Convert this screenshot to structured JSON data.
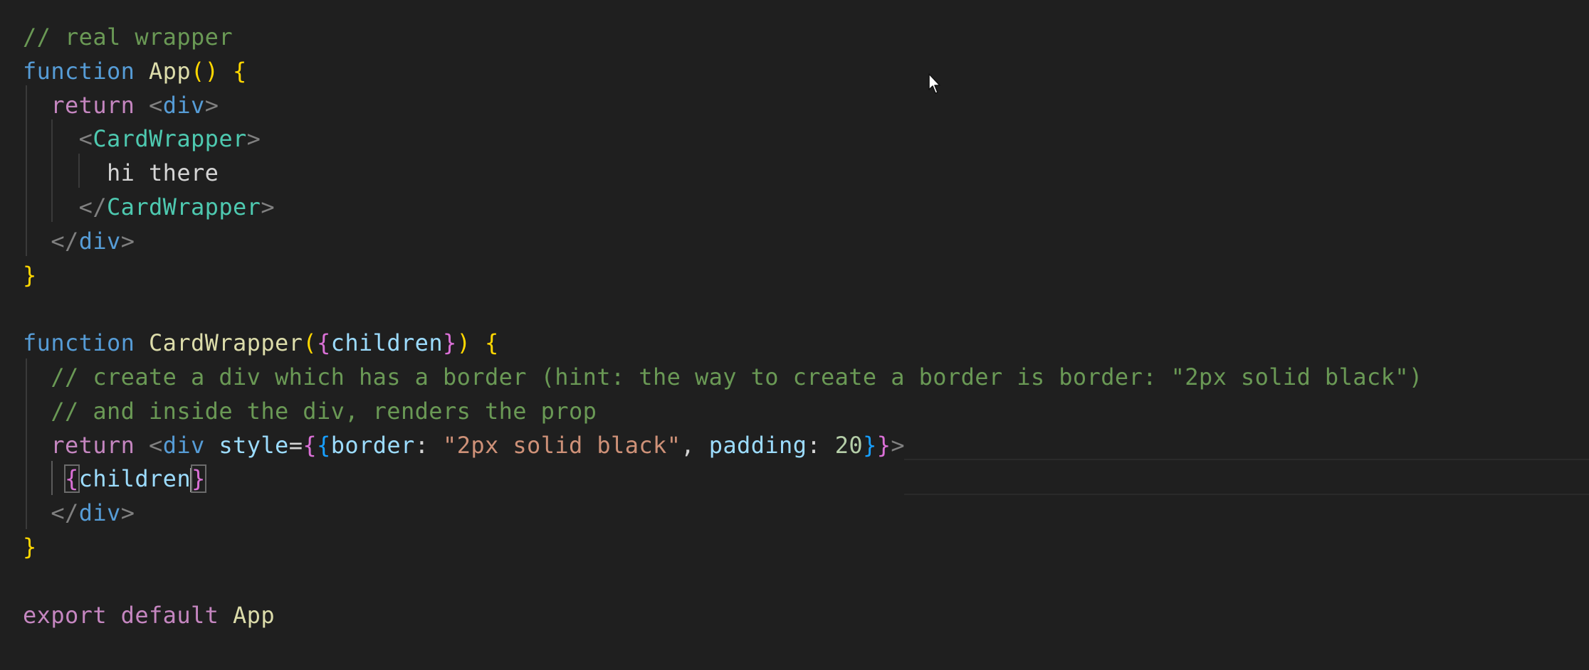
{
  "editor": {
    "lines": [
      {
        "tokens": [
          {
            "t": "// real wrapper",
            "k": "comment"
          }
        ]
      },
      {
        "tokens": [
          {
            "t": "function",
            "k": "keyword"
          },
          {
            "t": " ",
            "k": "text"
          },
          {
            "t": "App",
            "k": "func"
          },
          {
            "t": "()",
            "k": "b1"
          },
          {
            "t": " ",
            "k": "text"
          },
          {
            "t": "{",
            "k": "b1"
          }
        ]
      },
      {
        "tokens": [
          {
            "t": "  ",
            "k": "text"
          },
          {
            "t": "return",
            "k": "control"
          },
          {
            "t": " ",
            "k": "text"
          },
          {
            "t": "<",
            "k": "punct"
          },
          {
            "t": "div",
            "k": "tag"
          },
          {
            "t": ">",
            "k": "punct"
          }
        ]
      },
      {
        "tokens": [
          {
            "t": "    ",
            "k": "text"
          },
          {
            "t": "<",
            "k": "punct"
          },
          {
            "t": "CardWrapper",
            "k": "comp"
          },
          {
            "t": ">",
            "k": "punct"
          }
        ]
      },
      {
        "tokens": [
          {
            "t": "      ",
            "k": "text"
          },
          {
            "t": "hi there",
            "k": "text"
          }
        ]
      },
      {
        "tokens": [
          {
            "t": "    ",
            "k": "text"
          },
          {
            "t": "</",
            "k": "punct"
          },
          {
            "t": "CardWrapper",
            "k": "comp"
          },
          {
            "t": ">",
            "k": "punct"
          }
        ]
      },
      {
        "tokens": [
          {
            "t": "  ",
            "k": "text"
          },
          {
            "t": "</",
            "k": "punct"
          },
          {
            "t": "div",
            "k": "tag"
          },
          {
            "t": ">",
            "k": "punct"
          }
        ]
      },
      {
        "tokens": [
          {
            "t": "}",
            "k": "b1"
          }
        ]
      },
      {
        "tokens": []
      },
      {
        "tokens": [
          {
            "t": "function",
            "k": "keyword"
          },
          {
            "t": " ",
            "k": "text"
          },
          {
            "t": "CardWrapper",
            "k": "func"
          },
          {
            "t": "(",
            "k": "b1"
          },
          {
            "t": "{",
            "k": "b2"
          },
          {
            "t": "children",
            "k": "param"
          },
          {
            "t": "}",
            "k": "b2"
          },
          {
            "t": ")",
            "k": "b1"
          },
          {
            "t": " ",
            "k": "text"
          },
          {
            "t": "{",
            "k": "b1"
          }
        ]
      },
      {
        "tokens": [
          {
            "t": "  // create a div which has a border (hint: the way to create a border is border: \"2px solid black\")",
            "k": "comment"
          }
        ]
      },
      {
        "tokens": [
          {
            "t": "  // and inside the div, renders the prop",
            "k": "comment"
          }
        ]
      },
      {
        "tokens": [
          {
            "t": "  ",
            "k": "text"
          },
          {
            "t": "return",
            "k": "control"
          },
          {
            "t": " ",
            "k": "text"
          },
          {
            "t": "<",
            "k": "punct"
          },
          {
            "t": "div",
            "k": "tag"
          },
          {
            "t": " ",
            "k": "text"
          },
          {
            "t": "style",
            "k": "attr"
          },
          {
            "t": "=",
            "k": "op"
          },
          {
            "t": "{",
            "k": "b2"
          },
          {
            "t": "{",
            "k": "b3"
          },
          {
            "t": "border",
            "k": "attr"
          },
          {
            "t": ": ",
            "k": "op"
          },
          {
            "t": "\"2px solid black\"",
            "k": "string"
          },
          {
            "t": ", ",
            "k": "op"
          },
          {
            "t": "padding",
            "k": "attr"
          },
          {
            "t": ": ",
            "k": "op"
          },
          {
            "t": "20",
            "k": "number"
          },
          {
            "t": "}",
            "k": "b3"
          },
          {
            "t": "}",
            "k": "b2"
          },
          {
            "t": ">",
            "k": "punct"
          }
        ]
      },
      {
        "tokens": [
          {
            "t": "   ",
            "k": "text"
          },
          {
            "t": "{",
            "k": "b2",
            "match": true
          },
          {
            "t": "children",
            "k": "param"
          },
          {
            "t": "",
            "k": "caret"
          },
          {
            "t": "}",
            "k": "b2",
            "match": true
          }
        ]
      },
      {
        "tokens": [
          {
            "t": "  ",
            "k": "text"
          },
          {
            "t": "</",
            "k": "punct"
          },
          {
            "t": "div",
            "k": "tag"
          },
          {
            "t": ">",
            "k": "punct"
          }
        ]
      },
      {
        "tokens": [
          {
            "t": "}",
            "k": "b1"
          }
        ]
      },
      {
        "tokens": []
      },
      {
        "tokens": [
          {
            "t": "export",
            "k": "control"
          },
          {
            "t": " ",
            "k": "text"
          },
          {
            "t": "default",
            "k": "control"
          },
          {
            "t": " ",
            "k": "text"
          },
          {
            "t": "App",
            "k": "func"
          }
        ]
      }
    ]
  },
  "colors": {
    "background": "#1f1f1f",
    "comment": "#6a9955",
    "keyword": "#569cd6",
    "control": "#c586c0",
    "function": "#dcdcaa",
    "bracket_level_1": "#ffd700",
    "bracket_level_2": "#da70d6",
    "bracket_level_3": "#179fff",
    "component": "#4ec9b0",
    "string": "#ce9178",
    "number": "#b5cea8"
  },
  "icons": {
    "mouse_pointer": "arrow-cursor-icon"
  }
}
